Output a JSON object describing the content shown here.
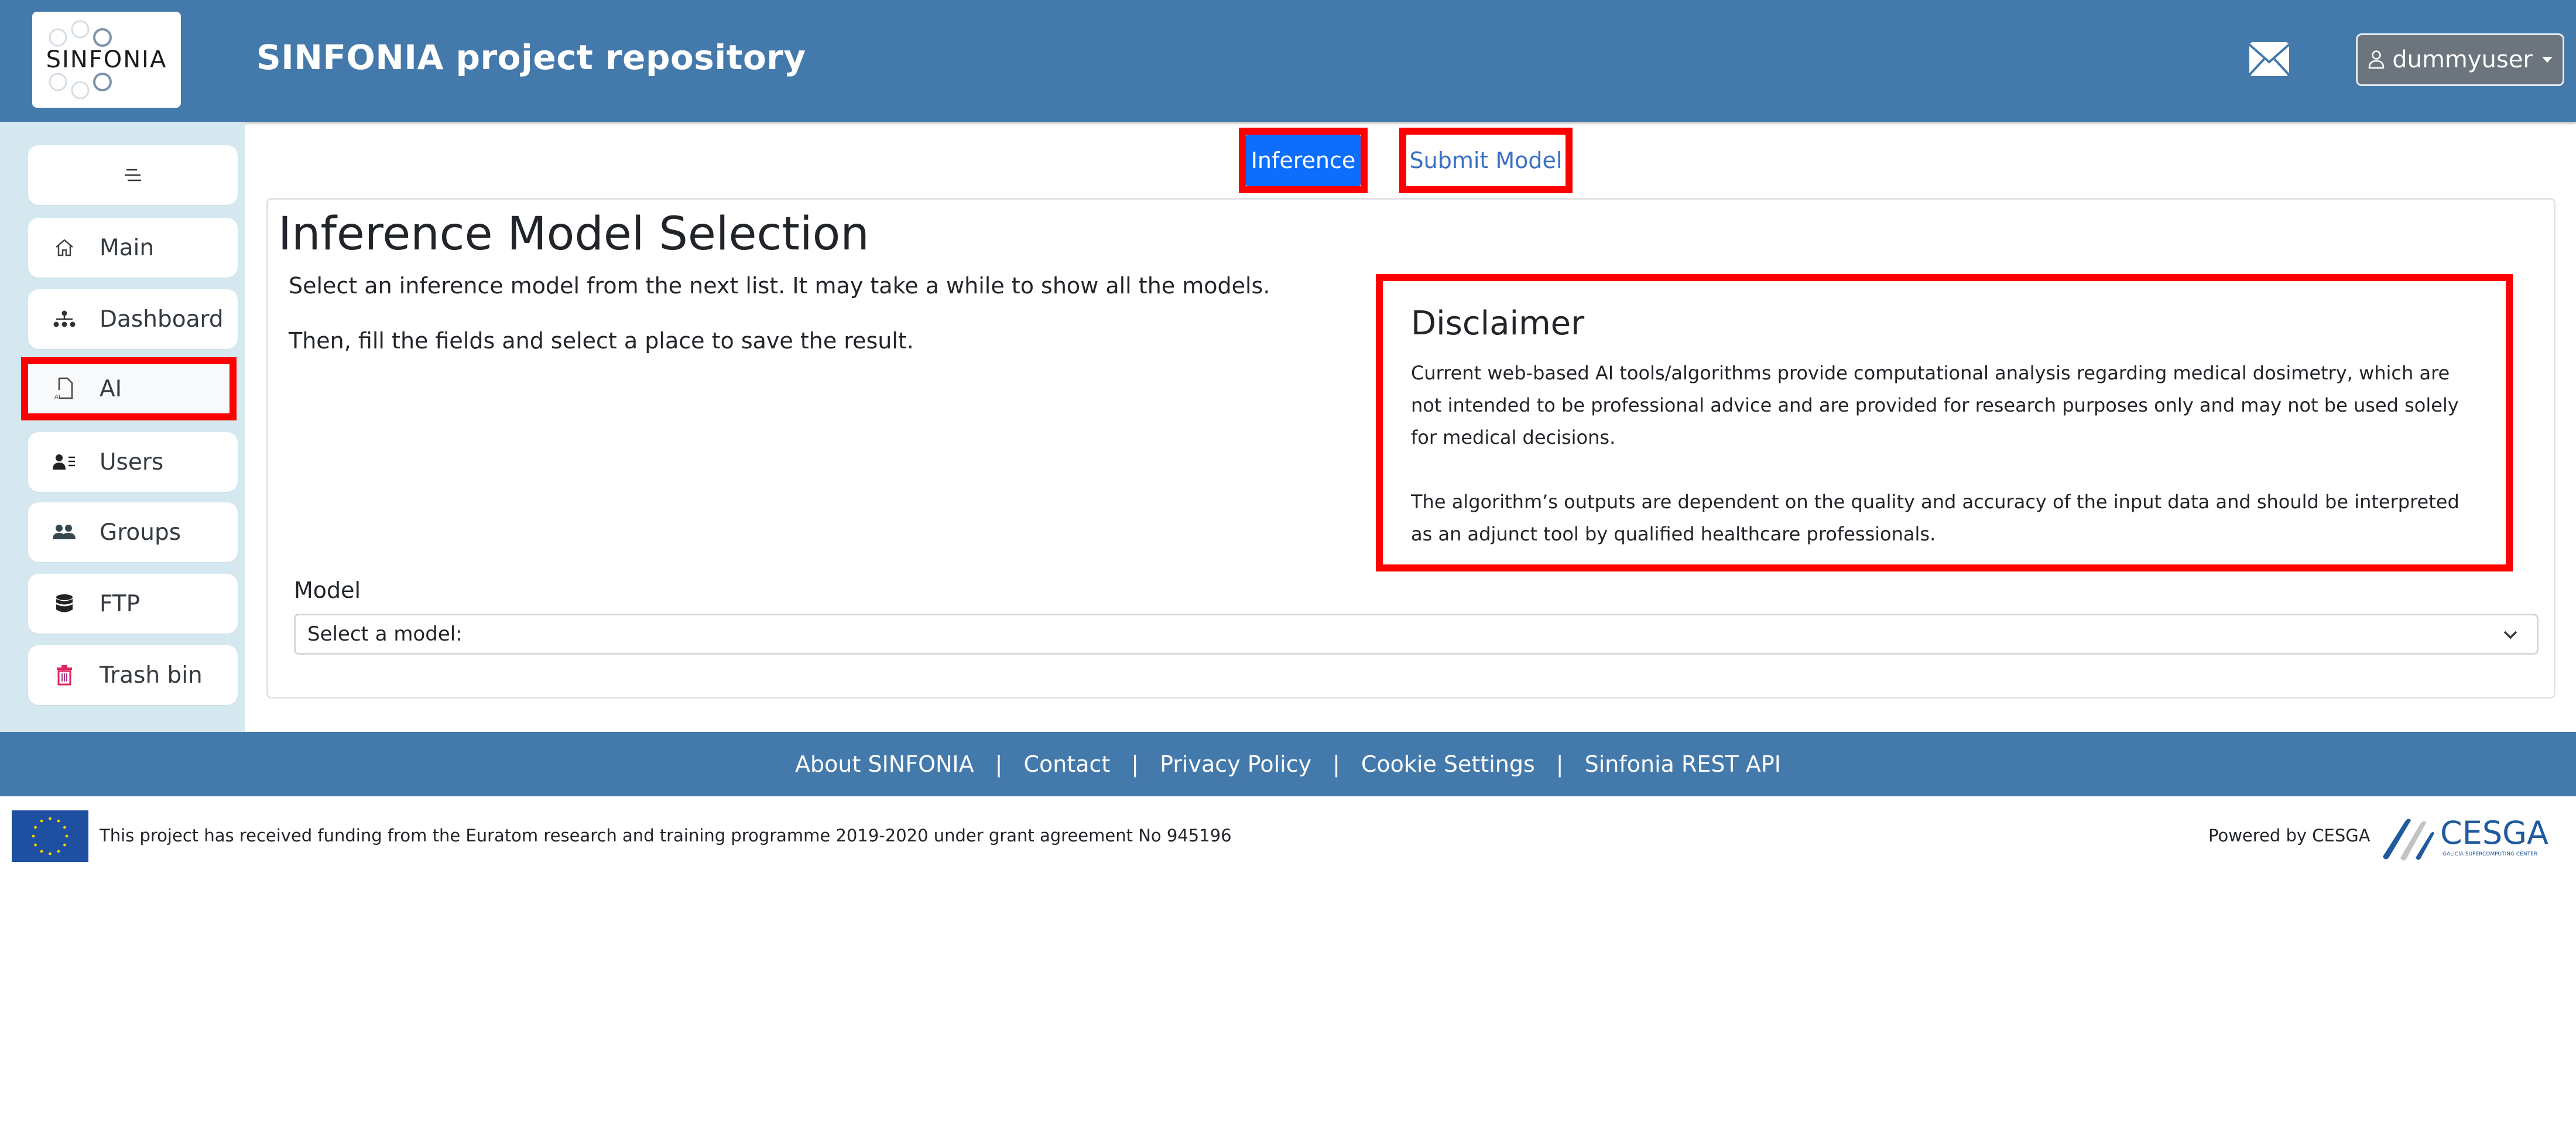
{
  "header": {
    "logo_text": "SINFONIA",
    "title": "SINFONIA project repository",
    "mail_icon": "envelope-icon",
    "user": {
      "icon": "person-icon",
      "name": "dummyuser"
    }
  },
  "sidebar": {
    "toggle_icon": "menu-lines-icon",
    "items": [
      {
        "label": "Main",
        "icon": "house-icon",
        "active": false
      },
      {
        "label": "Dashboard",
        "icon": "sitemap-icon",
        "active": false
      },
      {
        "label": "AI",
        "icon": "ai-file-icon",
        "active": true
      },
      {
        "label": "Users",
        "icon": "user-list-icon",
        "active": false
      },
      {
        "label": "Groups",
        "icon": "users-icon",
        "active": false
      },
      {
        "label": "FTP",
        "icon": "database-icon",
        "active": false
      },
      {
        "label": "Trash bin",
        "icon": "trash-icon",
        "active": false
      }
    ]
  },
  "tabs": [
    {
      "label": "Inference",
      "active": true
    },
    {
      "label": "Submit Model",
      "active": false
    }
  ],
  "main": {
    "title": "Inference Model Selection",
    "intro": [
      "Select an inference model from the next list. It may take a while to show all the models.",
      "Then, fill the fields and select a place to save the result."
    ],
    "disclaimer": {
      "title": "Disclaimer",
      "paragraphs": [
        "Current web-based AI tools/algorithms provide computational analysis regarding medical dosimetry, which are not intended to be professional advice and are provided for research purposes only and may not be used solely for medical decisions.",
        "The algorithm’s outputs are dependent on the quality and accuracy of the input data and should be interpreted as an adjunct tool by qualified healthcare professionals."
      ]
    },
    "model_field": {
      "label": "Model",
      "selected": "Select a model:"
    }
  },
  "footer": {
    "links": [
      "About SINFONIA",
      "Contact",
      "Privacy Policy",
      "Cookie Settings",
      "Sinfonia REST API"
    ],
    "separator": "|",
    "funding_text": "This project has received funding from the Euratom research and training programme 2019-2020 under grant agreement No 945196",
    "powered_by": "Powered by CESGA",
    "cesga_logo_text": "CESGA",
    "cesga_subtitle": "GALICIA SUPERCOMPUTING CENTER"
  },
  "colors": {
    "header_bg": "#4479ab",
    "sidebar_bg": "#d5e8f0",
    "primary": "#0d6efd",
    "highlight": "#ff0000",
    "user_button": "#6c757d",
    "trash_icon": "#e0245e"
  }
}
